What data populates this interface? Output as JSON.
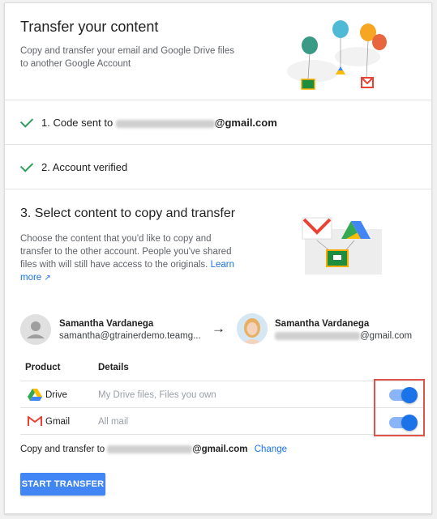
{
  "header": {
    "title": "Transfer your content",
    "description": "Copy and transfer your email and Google Drive files to another Google Account"
  },
  "steps": {
    "step1_prefix": "1. Code sent to",
    "step1_suffix": "@gmail.com",
    "step2": "2. Account verified"
  },
  "select": {
    "title": "3. Select content to copy and transfer",
    "description": "Choose the content that you'd like to copy and transfer to the other account. People you've shared files with will still have access to the originals.",
    "learn_more": "Learn more"
  },
  "accounts": {
    "from_name": "Samantha Vardanega",
    "from_email": "samantha@gtrainerdemo.teamg...",
    "to_name": "Samantha Vardanega",
    "to_email_suffix": "@gmail.com",
    "arrow": "→"
  },
  "table": {
    "headers": [
      "Product",
      "Details"
    ],
    "rows": [
      {
        "product": "Drive",
        "details": "My Drive files, Files you own",
        "enabled": true
      },
      {
        "product": "Gmail",
        "details": "All mail",
        "enabled": true
      }
    ]
  },
  "footer": {
    "copy_prefix": "Copy and transfer to",
    "copy_suffix": "@gmail.com",
    "change": "Change",
    "start_button": "START TRANSFER"
  },
  "colors": {
    "accent": "#1a73e8",
    "check": "#2e9d5b",
    "highlight": "#e0534a",
    "button": "#4285f4"
  }
}
